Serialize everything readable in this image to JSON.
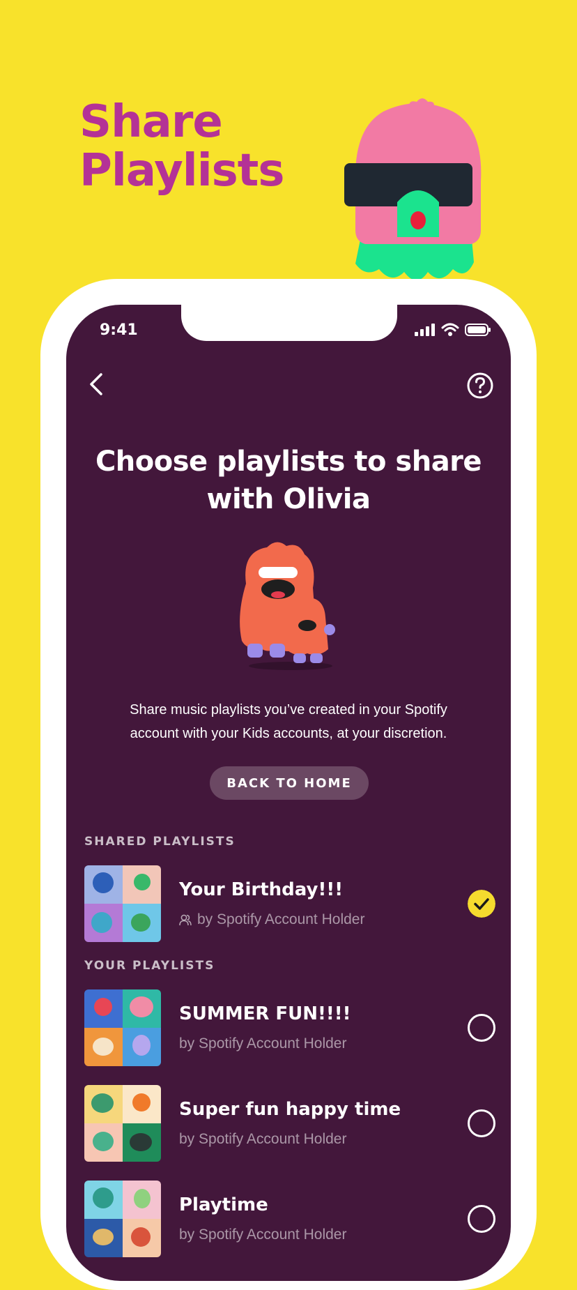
{
  "promo": {
    "title_line1": "Share",
    "title_line2": "Playlists"
  },
  "status_bar": {
    "time": "9:41"
  },
  "icons": {
    "back": "chevron-left-icon",
    "help": "question-circle-icon",
    "collaborator": "account-holder-icon",
    "check": "checkmark-icon",
    "signal": "cellular-signal-icon",
    "wifi": "wifi-icon",
    "battery": "battery-icon"
  },
  "screen": {
    "title_line1": "Choose playlists to share",
    "title_line2": "with Olivia",
    "description_line1": "Share music playlists you’ve created in your Spotify",
    "description_line2": "account with your Kids accounts, at your discretion.",
    "back_home_label": "BACK TO HOME"
  },
  "shared_section": {
    "heading": "SHARED PLAYLISTS",
    "items": [
      {
        "name": "Your Birthday!!!",
        "owner": "by Spotify Account Holder",
        "selected": true
      }
    ]
  },
  "your_section": {
    "heading": "YOUR PLAYLISTS",
    "items": [
      {
        "name": "SUMMER FUN!!!!",
        "owner": "by Spotify Account Holder",
        "selected": false
      },
      {
        "name": "Super fun happy time",
        "owner": "by Spotify Account Holder",
        "selected": false
      },
      {
        "name": "Playtime",
        "owner": "by Spotify Account Holder",
        "selected": false
      }
    ]
  },
  "colors": {
    "page_background": "#F8E22B",
    "promo_title": "#B43296",
    "screen_background": "#43173B",
    "button_background": "#6B4863",
    "check_yellow": "#F5DB2E",
    "mascot_pink": "#F27AA4",
    "mascot_green": "#1BE38E",
    "monster_orange": "#F26A4C"
  }
}
